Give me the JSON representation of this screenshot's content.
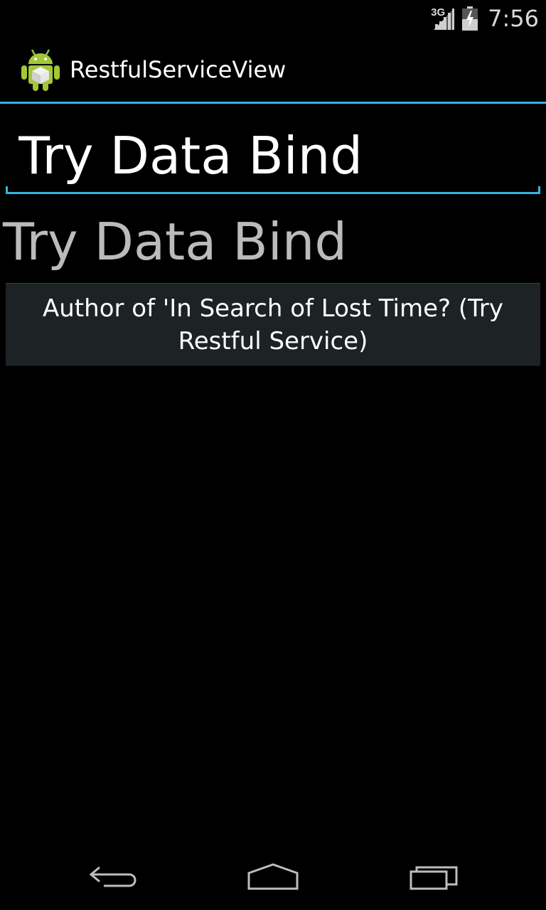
{
  "status_bar": {
    "network_type": "3G",
    "clock": "7:56",
    "icons": [
      "signal-icon",
      "battery-icon"
    ]
  },
  "action_bar": {
    "title": "RestfulServiceView",
    "icon": "android-app-icon",
    "accent_color": "#33b5e5"
  },
  "edit_field": {
    "value": "Try Data Bind"
  },
  "text_view": {
    "text": "Try Data Bind"
  },
  "button": {
    "label": "Author of 'In Search of Lost Time? (Try Restful Service)"
  },
  "nav_bar": {
    "icons": [
      "back-icon",
      "home-icon",
      "recents-icon"
    ]
  }
}
